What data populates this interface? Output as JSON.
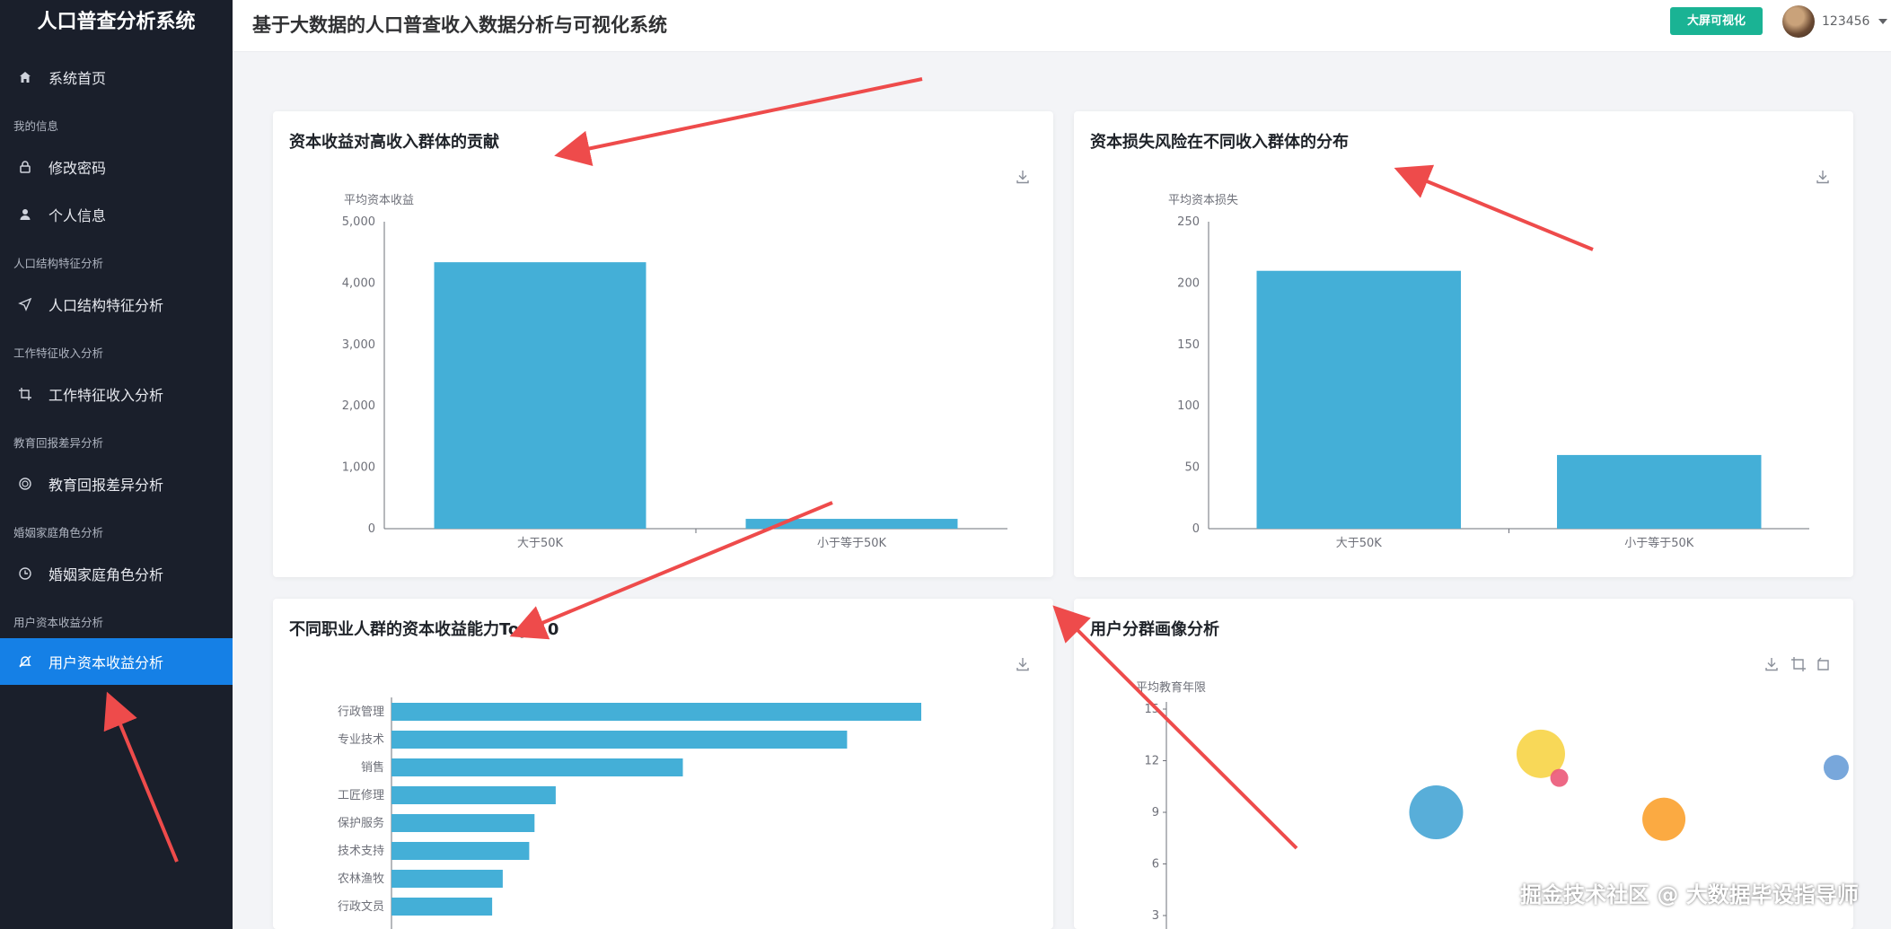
{
  "sidebar": {
    "brand": "人口普查分析系统",
    "items": [
      {
        "label": "系统首页",
        "group": null
      },
      {
        "label": "修改密码",
        "group": "我的信息"
      },
      {
        "label": "个人信息",
        "group": null
      },
      {
        "label": "人口结构特征分析",
        "group": "人口结构特征分析"
      },
      {
        "label": "工作特征收入分析",
        "group": "工作特征收入分析"
      },
      {
        "label": "教育回报差异分析",
        "group": "教育回报差异分析"
      },
      {
        "label": "婚姻家庭角色分析",
        "group": "婚姻家庭角色分析"
      },
      {
        "label": "用户资本收益分析",
        "group": "用户资本收益分析"
      }
    ],
    "active_index": 7,
    "accent": "#1580e6"
  },
  "header": {
    "title": "基于大数据的人口普查收入数据分析与可视化系统",
    "big_screen_button": "大屏可视化",
    "username": "123456"
  },
  "cards": {
    "c1": {
      "title": "资本收益对高收入群体的贡献"
    },
    "c2": {
      "title": "资本损失风险在不同收入群体的分布"
    },
    "c3": {
      "title": "不同职业人群的资本收益能力Top 10"
    },
    "c4": {
      "title": "用户分群画像分析"
    }
  },
  "chart_data": [
    {
      "type": "bar",
      "title": "资本收益对高收入群体的贡献",
      "ylabel": "平均资本收益",
      "categories": [
        "大于50K",
        "小于等于50K"
      ],
      "values": [
        4340,
        160
      ],
      "ylim": [
        0,
        5000
      ],
      "yticks": [
        0,
        1000,
        2000,
        3000,
        4000,
        5000
      ],
      "ytick_labels": [
        "0",
        "1,000",
        "2,000",
        "3,000",
        "4,000",
        "5,000"
      ],
      "color": "#44afd7"
    },
    {
      "type": "bar",
      "title": "资本损失风险在不同收入群体的分布",
      "ylabel": "平均资本损失",
      "categories": [
        "大于50K",
        "小于等于50K"
      ],
      "values": [
        210,
        60
      ],
      "ylim": [
        0,
        250
      ],
      "yticks": [
        0,
        50,
        100,
        150,
        200,
        250
      ],
      "ytick_labels": [
        "0",
        "50",
        "100",
        "150",
        "200",
        "250"
      ],
      "color": "#44afd7"
    },
    {
      "type": "bar",
      "orientation": "horizontal",
      "title": "不同职业人群的资本收益能力Top 10",
      "categories": [
        "行政管理",
        "专业技术",
        "销售",
        "工匠修理",
        "保护服务",
        "技术支持",
        "农林渔牧",
        "行政文员"
      ],
      "values": [
        100,
        86,
        55,
        31,
        27,
        26,
        21,
        19
      ],
      "color": "#44afd7"
    },
    {
      "type": "scatter",
      "title": "用户分群画像分析",
      "ylabel": "平均教育年限",
      "yticks": [
        3,
        6,
        9,
        12,
        15
      ],
      "ytick_labels": [
        "3",
        "6",
        "9",
        "12",
        "15"
      ],
      "ylim": [
        2,
        15
      ],
      "points": [
        {
          "x": 0.38,
          "y": 9.0,
          "r": 30,
          "color": "#4aa7d6"
        },
        {
          "x": 0.55,
          "y": 12.4,
          "r": 27,
          "color": "#f7d54a"
        },
        {
          "x": 0.58,
          "y": 11.0,
          "r": 10,
          "color": "#ec5b7b"
        },
        {
          "x": 0.75,
          "y": 8.6,
          "r": 24,
          "color": "#fba332"
        },
        {
          "x": 1.03,
          "y": 11.6,
          "r": 14,
          "color": "#6d9fd8"
        }
      ]
    }
  ],
  "watermark": "掘金技术社区 @ 大数据毕设指导师"
}
